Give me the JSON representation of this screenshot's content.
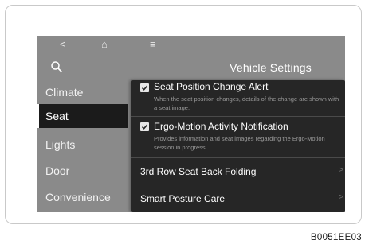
{
  "window": {
    "title": "Vehicle Settings"
  },
  "topbar": {
    "back_icon": "<",
    "home_icon": "⌂",
    "menu_icon": "≡"
  },
  "sidebar": {
    "items": [
      {
        "label": "Climate",
        "active": false
      },
      {
        "label": "Seat",
        "active": true
      },
      {
        "label": "Lights",
        "active": false
      },
      {
        "label": "Door",
        "active": false
      },
      {
        "label": "Convenience",
        "active": false
      }
    ]
  },
  "panel": {
    "options": [
      {
        "title": "Seat Position Change Alert",
        "checked": true,
        "description": "When the seat position changes, details of the change are shown with a seat image."
      },
      {
        "title": "Ergo-Motion Activity Notification",
        "checked": true,
        "description": "Provides information and seat images regarding the Ergo-Motion session in progress."
      }
    ],
    "rows": [
      {
        "title": "3rd Row Seat Back Folding",
        "chevron": ">"
      },
      {
        "title": "Smart Posture Care",
        "chevron": ">"
      }
    ]
  },
  "footer": {
    "code": "B0051EE03"
  },
  "colors": {
    "screen_bg": "#8a8a8a",
    "panel_bg": "#262626",
    "active_item_bg": "#1b1b1b",
    "text_primary": "#ffffff",
    "text_muted": "#9a9a9a"
  }
}
